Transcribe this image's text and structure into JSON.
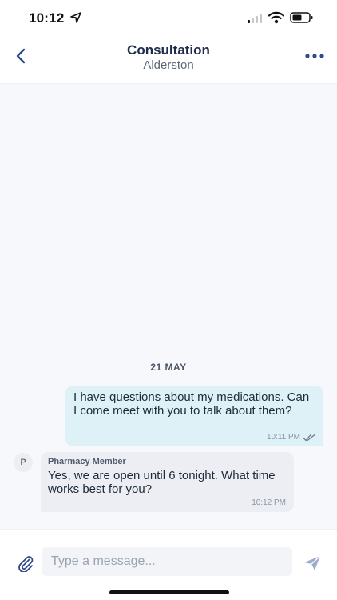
{
  "status_bar": {
    "time": "10:12"
  },
  "header": {
    "title": "Consultation",
    "subtitle": "Alderston"
  },
  "chat": {
    "date_label": "21 MAY",
    "messages": [
      {
        "direction": "outgoing",
        "text": "I have questions about my medications. Can I come meet with you to talk about them?",
        "time": "10:11 PM",
        "read_status": "double-check-icon"
      },
      {
        "direction": "incoming",
        "avatar_initial": "P",
        "sender": "Pharmacy Member",
        "text": "Yes, we are open until 6 tonight.  What time works best for you?",
        "time": "10:12 PM"
      }
    ]
  },
  "composer": {
    "placeholder": "Type a message...",
    "value": ""
  },
  "icons": {
    "back": "chevron-left-icon",
    "more": "more-dots-icon",
    "attach": "paperclip-icon",
    "send": "send-icon"
  },
  "colors": {
    "accent": "#2f4a86",
    "outgoing_bubble": "#ddf1f7",
    "incoming_bubble": "#eceef3",
    "chat_background": "#f7f8fb"
  }
}
